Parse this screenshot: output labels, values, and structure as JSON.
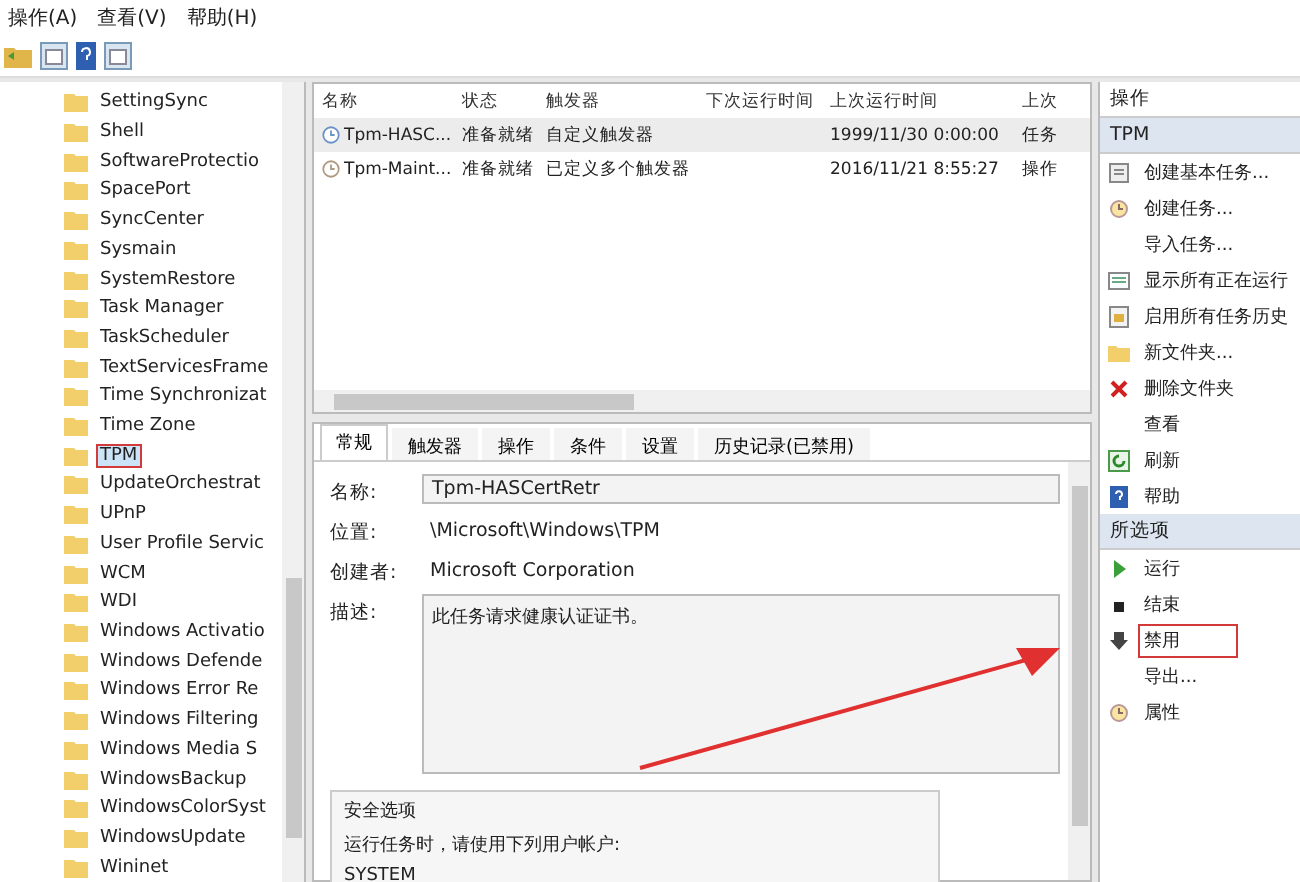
{
  "menu_bar": [
    "操作(A)",
    "查看(V)",
    "帮助(H)"
  ],
  "tree": {
    "items": [
      {
        "label": "SettingSync",
        "selected": false,
        "highlighted": false
      },
      {
        "label": "Shell",
        "selected": false,
        "highlighted": false
      },
      {
        "label": "SoftwareProtectio",
        "selected": false,
        "highlighted": false
      },
      {
        "label": "SpacePort",
        "selected": false,
        "highlighted": false
      },
      {
        "label": "SyncCenter",
        "selected": false,
        "highlighted": false
      },
      {
        "label": "Sysmain",
        "selected": false,
        "highlighted": false
      },
      {
        "label": "SystemRestore",
        "selected": false,
        "highlighted": false
      },
      {
        "label": "Task Manager",
        "selected": false,
        "highlighted": false
      },
      {
        "label": "TaskScheduler",
        "selected": false,
        "highlighted": false
      },
      {
        "label": "TextServicesFrame",
        "selected": false,
        "highlighted": false
      },
      {
        "label": "Time Synchronizat",
        "selected": false,
        "highlighted": false
      },
      {
        "label": "Time Zone",
        "selected": false,
        "highlighted": false
      },
      {
        "label": "TPM",
        "selected": true,
        "highlighted": true
      },
      {
        "label": "UpdateOrchestrat",
        "selected": false,
        "highlighted": false
      },
      {
        "label": "UPnP",
        "selected": false,
        "highlighted": false
      },
      {
        "label": "User Profile Servic",
        "selected": false,
        "highlighted": false
      },
      {
        "label": "WCM",
        "selected": false,
        "highlighted": false
      },
      {
        "label": "WDI",
        "selected": false,
        "highlighted": false
      },
      {
        "label": "Windows Activatio",
        "selected": false,
        "highlighted": false
      },
      {
        "label": "Windows Defende",
        "selected": false,
        "highlighted": false
      },
      {
        "label": "Windows Error Re",
        "selected": false,
        "highlighted": false
      },
      {
        "label": "Windows Filtering",
        "selected": false,
        "highlighted": false
      },
      {
        "label": "Windows Media S",
        "selected": false,
        "highlighted": false
      },
      {
        "label": "WindowsBackup",
        "selected": false,
        "highlighted": false
      },
      {
        "label": "WindowsColorSyst",
        "selected": false,
        "highlighted": false
      },
      {
        "label": "WindowsUpdate",
        "selected": false,
        "highlighted": false
      },
      {
        "label": "Wininet",
        "selected": false,
        "highlighted": false
      }
    ]
  },
  "task_list": {
    "columns": [
      "名称",
      "状态",
      "触发器",
      "下次运行时间",
      "上次运行时间",
      "上次"
    ],
    "rows": [
      {
        "selected": true,
        "cells": [
          "Tpm-HASC...",
          "准备就绪",
          "自定义触发器",
          "",
          "1999/11/30 0:00:00",
          "任务"
        ]
      },
      {
        "selected": false,
        "cells": [
          "Tpm-Maint...",
          "准备就绪",
          "已定义多个触发器",
          "",
          "2016/11/21 8:55:27",
          "操作"
        ]
      }
    ]
  },
  "detail_tabs": [
    {
      "label": "常规",
      "selected": true
    },
    {
      "label": "触发器",
      "selected": false
    },
    {
      "label": "操作",
      "selected": false
    },
    {
      "label": "条件",
      "selected": false
    },
    {
      "label": "设置",
      "selected": false
    },
    {
      "label": "历史记录(已禁用)",
      "selected": false
    }
  ],
  "general": {
    "name_label": "名称:",
    "name_value": "Tpm-HASCertRetr",
    "location_label": "位置:",
    "location_value": "\\Microsoft\\Windows\\TPM",
    "author_label": "创建者:",
    "author_value": "Microsoft Corporation",
    "description_label": "描述:",
    "description_value": "此任务请求健康认证证书。",
    "security_title": "安全选项",
    "security_text": "运行任务时，请使用下列用户帐户:",
    "security_account": "SYSTEM"
  },
  "actions": {
    "title": "操作",
    "sections": [
      {
        "title": "TPM",
        "items": [
          {
            "label": "创建基本任务...",
            "kind": "task",
            "highlighted": false
          },
          {
            "label": "创建任务...",
            "kind": "clock",
            "highlighted": false
          },
          {
            "label": "导入任务...",
            "kind": "plain",
            "highlighted": false
          },
          {
            "label": "显示所有正在运行",
            "kind": "list",
            "highlighted": false
          },
          {
            "label": "启用所有任务历史",
            "kind": "history",
            "highlighted": false
          },
          {
            "label": "新文件夹...",
            "kind": "folder",
            "highlighted": false
          },
          {
            "label": "删除文件夹",
            "kind": "delete",
            "highlighted": false
          },
          {
            "label": "查看",
            "kind": "plain",
            "highlighted": false
          },
          {
            "label": "刷新",
            "kind": "refresh",
            "highlighted": false
          },
          {
            "label": "帮助",
            "kind": "help",
            "highlighted": false
          }
        ]
      },
      {
        "title": "所选项",
        "items": [
          {
            "label": "运行",
            "kind": "run",
            "highlighted": false
          },
          {
            "label": "结束",
            "kind": "stop",
            "highlighted": false
          },
          {
            "label": "禁用",
            "kind": "disable",
            "highlighted": true
          },
          {
            "label": "导出...",
            "kind": "plain",
            "highlighted": false
          },
          {
            "label": "属性",
            "kind": "clock",
            "highlighted": false
          }
        ]
      }
    ]
  }
}
